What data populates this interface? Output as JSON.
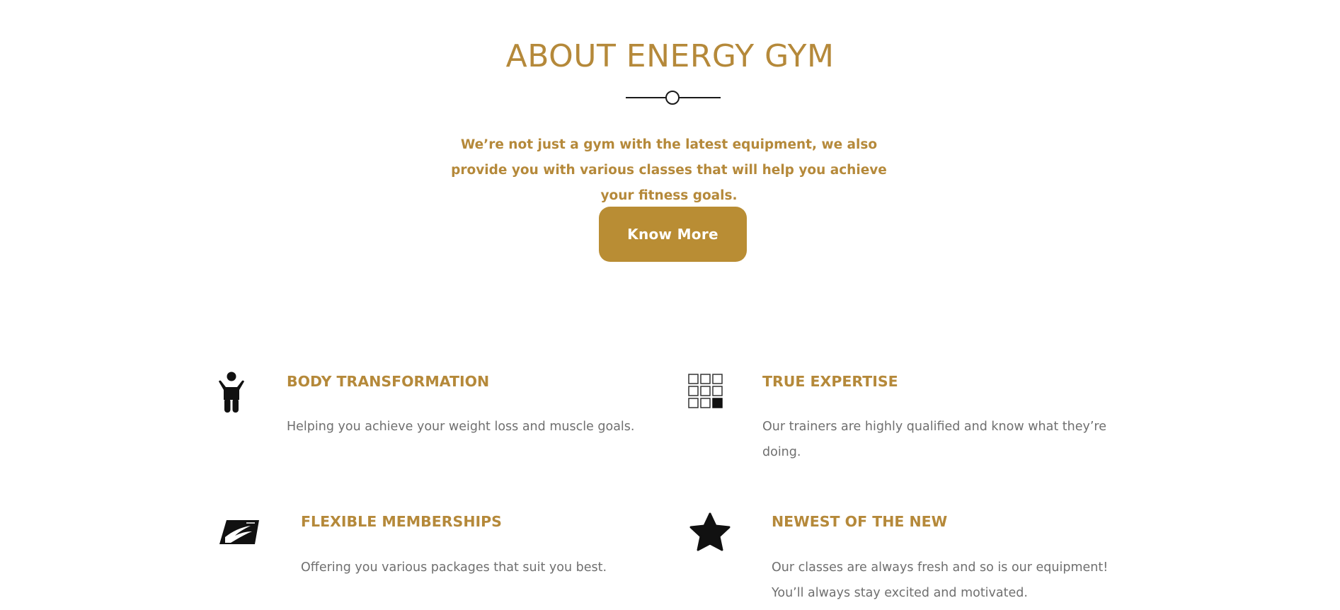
{
  "about": {
    "title": "ABOUT ENERGY GYM",
    "intro": "We’re not just a gym with the latest equipment, we also provide you with various classes that will help you achieve your fitness goals.",
    "cta_label": "Know More"
  },
  "features": [
    {
      "icon": "child-icon",
      "title": "BODY TRANSFORMATION",
      "description": "Helping you achieve your weight loss and muscle goals."
    },
    {
      "icon": "grid-squares-icon",
      "title": "TRUE EXPERTISE",
      "description": "Our trainers are highly qualified and know what they’re doing."
    },
    {
      "icon": "postal-eagle-icon",
      "title": "FLEXIBLE MEMBERSHIPS",
      "description": "Offering you various packages that suit you best."
    },
    {
      "icon": "star-icon",
      "title": "NEWEST OF THE NEW",
      "description": "Our classes are always fresh and so is our equipment! You’ll always stay excited and motivated."
    }
  ],
  "colors": {
    "accent": "#b5893a",
    "button": "#b98d34",
    "body_text": "#6f6f6f",
    "icon": "#111111"
  }
}
